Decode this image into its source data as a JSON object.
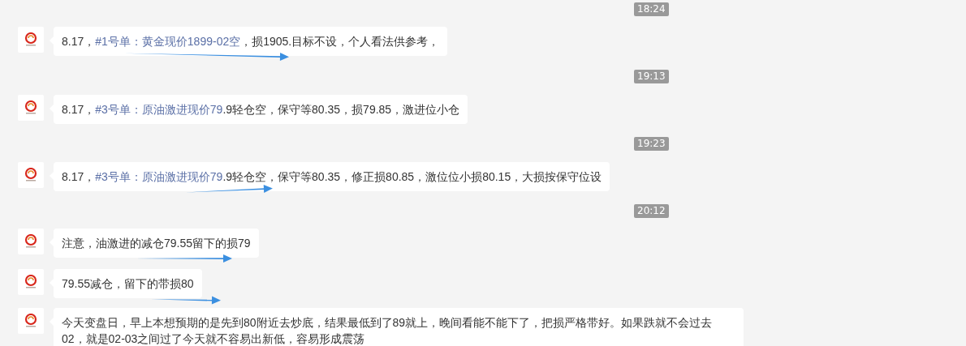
{
  "feed": [
    {
      "kind": "time",
      "text": "18:24"
    },
    {
      "kind": "message",
      "arrow": true,
      "segments": [
        {
          "kind": "plain",
          "text": "8.17，"
        },
        {
          "kind": "link",
          "text": "#1号单：黄金现价1899-02空"
        },
        {
          "kind": "plain",
          "text": "，损1905.目标不设，个人看法供参考，"
        }
      ]
    },
    {
      "kind": "time",
      "text": "19:13"
    },
    {
      "kind": "message",
      "arrow": false,
      "segments": [
        {
          "kind": "plain",
          "text": "8.17，"
        },
        {
          "kind": "link",
          "text": "#3号单：原油激进现价79"
        },
        {
          "kind": "plain",
          "text": ".9轻仓空，保守等80.35，损79.85，激进位小仓"
        }
      ]
    },
    {
      "kind": "time",
      "text": "19:23"
    },
    {
      "kind": "message",
      "arrow": true,
      "segments": [
        {
          "kind": "plain",
          "text": "8.17，"
        },
        {
          "kind": "link",
          "text": "#3号单：原油激进现价79"
        },
        {
          "kind": "plain",
          "text": ".9轻仓空，保守等80.35，修正损80.85，激位位小损80.15，大损按保守位设"
        }
      ]
    },
    {
      "kind": "time",
      "text": "20:12"
    },
    {
      "kind": "message",
      "arrow": true,
      "segments": [
        {
          "kind": "plain",
          "text": "注意，油激进的减仓79.55留下的损79"
        }
      ]
    },
    {
      "kind": "message",
      "arrow": true,
      "segments": [
        {
          "kind": "plain",
          "text": "79.55减仓，留下的带损80"
        }
      ]
    },
    {
      "kind": "message",
      "arrow": false,
      "segments": [
        {
          "kind": "plain",
          "text": "今天变盘日，早上本想预期的是先到80附近去炒底，结果最低到了89就上，晚间看能不能下了，把损严格带好。如果跌就不会过去02，就是02-03之间过了今天就不容易出新低，容易形成震荡"
        }
      ]
    }
  ]
}
